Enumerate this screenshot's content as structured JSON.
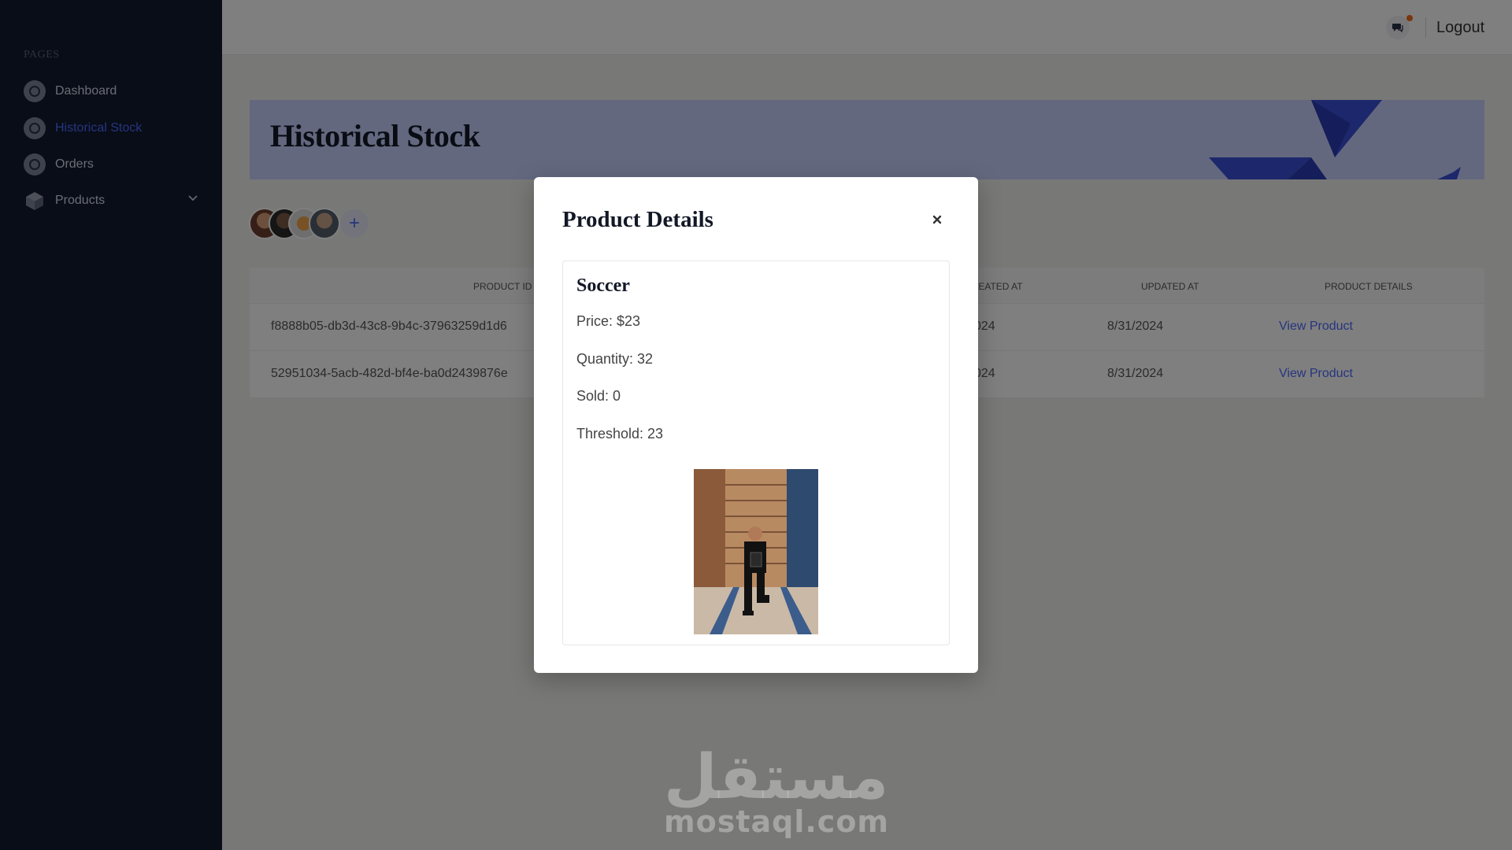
{
  "sidebar": {
    "section_label": "PAGES",
    "items": [
      {
        "label": "Dashboard",
        "icon": "dashboard-icon"
      },
      {
        "label": "Historical Stock",
        "icon": "history-icon",
        "active": true
      },
      {
        "label": "Orders",
        "icon": "orders-icon"
      },
      {
        "label": "Products",
        "icon": "box-icon",
        "expandable": true
      }
    ]
  },
  "topbar": {
    "chat_icon": "chat-icon",
    "logout_label": "Logout"
  },
  "page": {
    "title": "Historical Stock"
  },
  "table": {
    "headers": [
      "PRODUCT ID",
      "CREATED AT",
      "UPDATED AT",
      "PRODUCT DETAILS"
    ],
    "rows": [
      {
        "product_id": "f8888b05-db3d-43c8-9b4c-37963259d1d6",
        "created_at": "024",
        "updated_at": "8/31/2024",
        "details_link": "View Product"
      },
      {
        "product_id": "52951034-5acb-482d-bf4e-ba0d2439876e",
        "created_at": "024",
        "updated_at": "8/31/2024",
        "details_link": "View Product"
      }
    ]
  },
  "modal": {
    "title": "Product Details",
    "close_icon": "close-icon",
    "product": {
      "name": "Soccer",
      "price_label": "Price:",
      "price_value": "$23",
      "quantity_label": "Quantity:",
      "quantity_value": "32",
      "sold_label": "Sold:",
      "sold_value": "0",
      "threshold_label": "Threshold:",
      "threshold_value": "23"
    }
  },
  "watermark": {
    "arabic": "مستقل",
    "latin": "mostaql.com"
  },
  "colors": {
    "sidebar_bg": "#111b30",
    "accent": "#4d6aff",
    "banner_bg": "#c7d1ff",
    "notification_dot": "#f26b1d"
  }
}
